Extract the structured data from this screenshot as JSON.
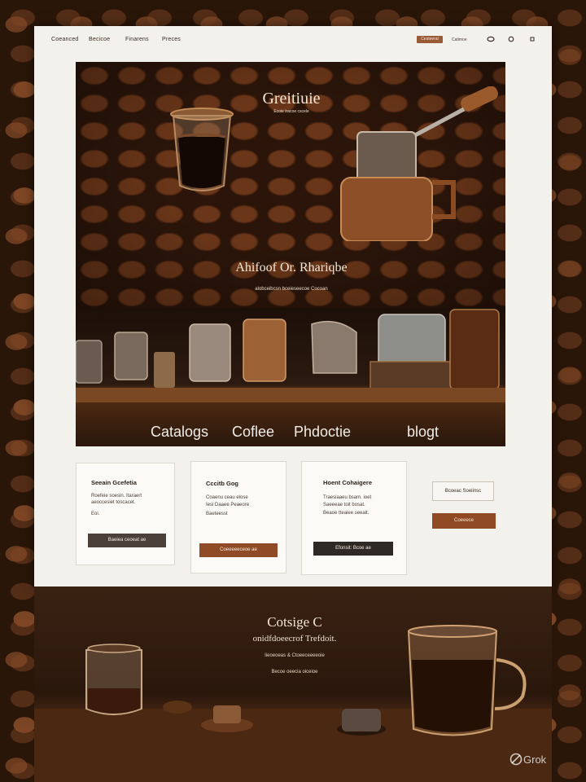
{
  "nav": {
    "links": [
      "Coeanced",
      "Becicoe",
      "Finarens",
      "Preces"
    ],
    "cta": "Cesteerai",
    "small_link": "Catimoe",
    "icons": [
      "user-icon",
      "search-icon",
      "info-icon"
    ]
  },
  "hero": {
    "title": "Greitiuie",
    "subtitle": "Ecoie tracoe cscele",
    "headline": "Ahifoof Or. Rhariqbe",
    "tagline": "alobceibcsn bceieseecoe Cocoan"
  },
  "shelf": {
    "nav_items": [
      "Catalogs",
      "Coflee",
      "Phdoctie",
      "blogt"
    ]
  },
  "cards": [
    {
      "title": "Seeain Gcefetia",
      "lines": [
        "Roefeie soesin. Itaraert",
        "aeoccesiet toscacet.",
        "Eoi."
      ],
      "button": "Baeiea ceoeat ae"
    },
    {
      "title": "Cccitb Gog",
      "lines": [
        "Coaenu ceau elose",
        "Iesi Daaee Peaeore",
        "Baeteesst"
      ],
      "button": "Coeeeeeceoe ae"
    },
    {
      "title": "Hoent Cohaigere",
      "lines": [
        "Traesiaaeu bsam. ioet",
        "Saeeeae toit bosat.",
        "Beaoe tteaiee seeait."
      ],
      "button": "Efonsit: Bcoe ae"
    }
  ],
  "side": {
    "box_label": "Bcoeac Soeiinsc",
    "button": "Coeeece"
  },
  "footer": {
    "title": "Cotsige C",
    "subtitle": "onidfdoeecrof Trefdoit.",
    "line1": "Iieoeoeas & Ctoeeceeeeoie",
    "line2": "Becoe oeecia oiceioe"
  },
  "watermark": "Grok",
  "colors": {
    "page_bg": "#f3f1ec",
    "accent_copper": "#9a5a36",
    "dark_button": "#3b302a",
    "coffee_dark": "#2b150a"
  }
}
